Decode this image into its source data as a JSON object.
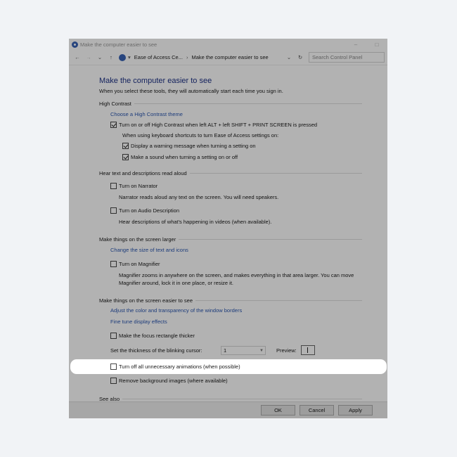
{
  "window": {
    "title": "Make the computer easier to see",
    "minimize": "–",
    "maximize": "□"
  },
  "nav": {
    "back": "←",
    "forward": "→",
    "recent": "⌄",
    "up": "↑",
    "crumb_arrow": "▾",
    "breadcrumb": [
      "Ease of Access Ce...",
      "Make the computer easier to see"
    ],
    "breadcrumb_sep": "›",
    "dropdown": "⌄",
    "refresh": "↻",
    "search_placeholder": "Search Control Panel"
  },
  "page": {
    "title": "Make the computer easier to see",
    "subtitle": "When you select these tools, they will automatically start each time you sign in."
  },
  "high_contrast": {
    "heading": "High Contrast",
    "link": "Choose a High Contrast theme",
    "toggle_label": "Turn on or off High Contrast when left ALT + left SHIFT + PRINT SCREEN is pressed",
    "toggle_checked": true,
    "shortcuts_note": "When using keyboard shortcuts to turn Ease of Access settings on:",
    "warning_label": "Display a warning message when turning a setting on",
    "warning_checked": true,
    "sound_label": "Make a sound when turning a setting on or off",
    "sound_checked": true
  },
  "hear": {
    "heading": "Hear text and descriptions read aloud",
    "narrator_label": "Turn on Narrator",
    "narrator_checked": false,
    "narrator_desc": "Narrator reads aloud any text on the screen. You will need speakers.",
    "audio_desc_label": "Turn on Audio Description",
    "audio_desc_checked": false,
    "audio_desc_desc": "Hear descriptions of what's happening in videos (when available)."
  },
  "larger": {
    "heading": "Make things on the screen larger",
    "link": "Change the size of text and icons",
    "magnifier_label": "Turn on Magnifier",
    "magnifier_checked": false,
    "magnifier_desc_1": "Magnifier zooms in anywhere on the screen, and makes everything in that area larger. You can move",
    "magnifier_desc_2": "Magnifier around, lock it in one place, or resize it."
  },
  "easier": {
    "heading": "Make things on the screen easier to see",
    "link_borders": "Adjust the color and transparency of the window borders",
    "link_effects": "Fine tune display effects",
    "focus_label": "Make the focus rectangle thicker",
    "focus_checked": false,
    "cursor_label": "Set the thickness of the blinking cursor:",
    "cursor_value": "1",
    "preview_label": "Preview:",
    "animations_label": "Turn off all unnecessary animations (when possible)",
    "animations_checked": false,
    "background_label": "Remove background images (where available)",
    "background_checked": false
  },
  "see_also": {
    "heading": "See also"
  },
  "buttons": {
    "ok": "OK",
    "cancel": "Cancel",
    "apply": "Apply"
  }
}
